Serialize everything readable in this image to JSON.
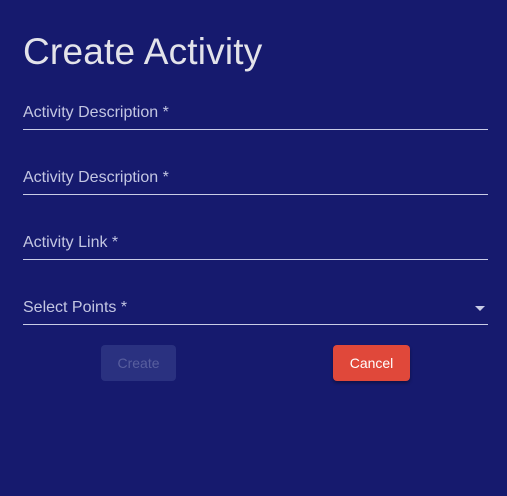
{
  "dialog": {
    "title": "Create Activity"
  },
  "form": {
    "fields": [
      {
        "label": "Activity Description *",
        "value": ""
      },
      {
        "label": "Activity Description *",
        "value": ""
      },
      {
        "label": "Activity Link *",
        "value": ""
      }
    ],
    "select": {
      "label": "Select Points *",
      "icon": "arrow-drop-down-icon"
    }
  },
  "actions": {
    "create_label": "Create",
    "create_disabled": true,
    "cancel_label": "Cancel"
  },
  "colors": {
    "background": "#161a6e",
    "title_text": "#e3e3ea",
    "underline": "#c9cce6",
    "cancel_button": "#e0483a",
    "create_button_disabled": "#2a3180"
  }
}
